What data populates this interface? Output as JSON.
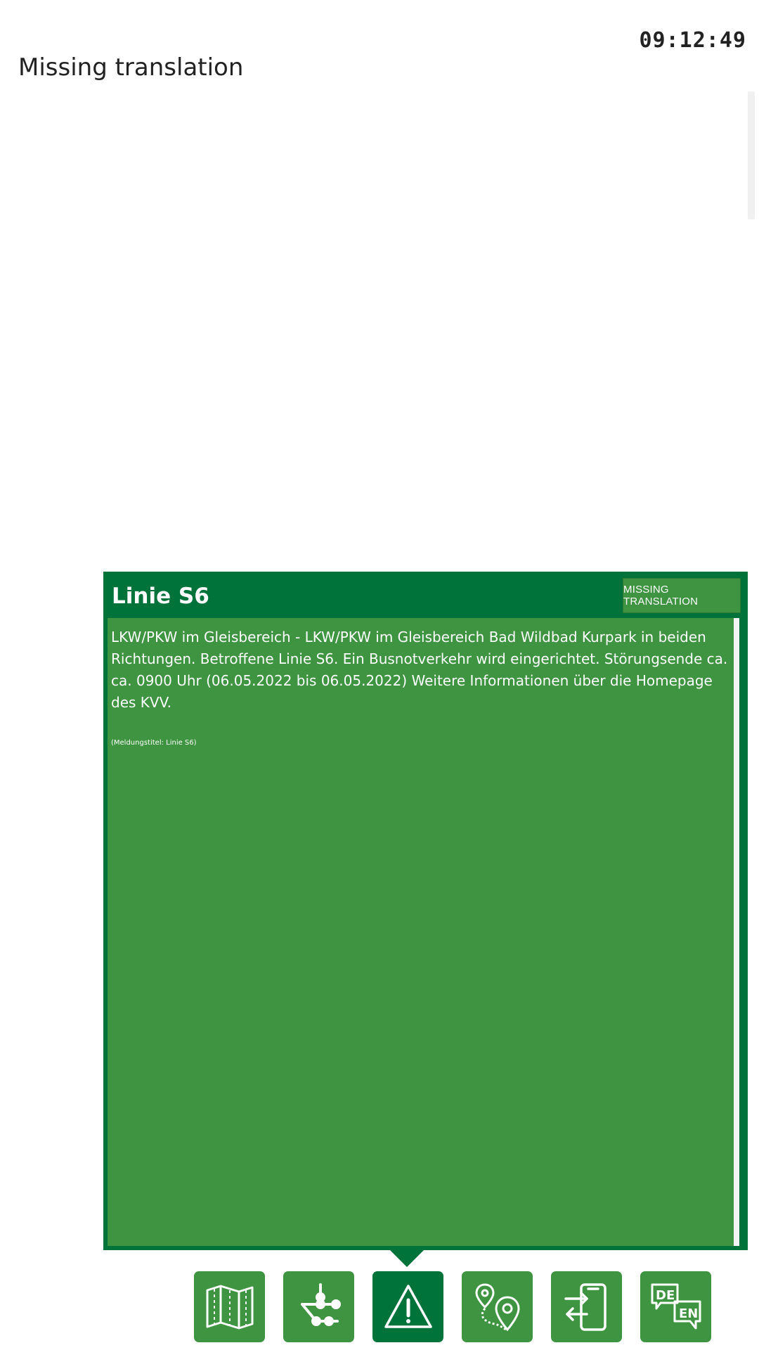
{
  "header": {
    "clock": "09:12:49",
    "title": "Missing translation"
  },
  "message": {
    "title": "Linie S6",
    "translate_button": "MISSING TRANSLATION",
    "body": "LKW/PKW im Gleisbereich - LKW/PKW im Gleisbereich Bad Wildbad Kurpark in beiden Richtungen. Betroffene Linie S6. Ein Busnotverkehr wird eingerichtet. Störungsende ca. ca. 0900 Uhr (06.05.2022 bis 06.05.2022) Weitere Informationen über die Homepage des KVV.",
    "meta": "(Meldungstitel: Linie S6)"
  },
  "nav": {
    "items": [
      {
        "icon": "map-icon",
        "active": false
      },
      {
        "icon": "network-icon",
        "active": false
      },
      {
        "icon": "warning-icon",
        "active": true
      },
      {
        "icon": "route-pin-icon",
        "active": false
      },
      {
        "icon": "phone-transfer-icon",
        "active": false
      },
      {
        "icon": "language-icon",
        "active": false,
        "labels": [
          "DE",
          "EN"
        ]
      }
    ]
  },
  "colors": {
    "dark_green": "#00733a",
    "green": "#3e9440",
    "text_dark": "#222222"
  }
}
